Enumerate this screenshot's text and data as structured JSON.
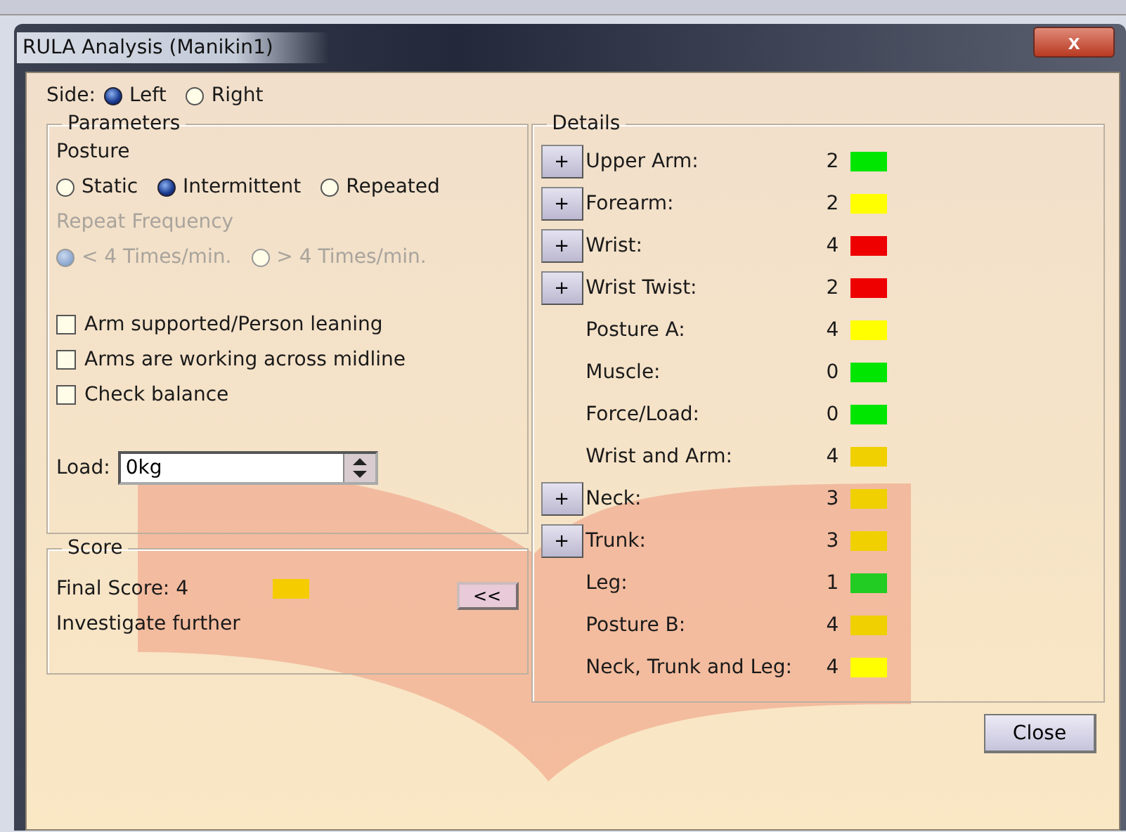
{
  "window": {
    "title": "RULA Analysis (Manikin1)",
    "close_glyph": "x"
  },
  "side": {
    "label": "Side:",
    "options": [
      {
        "label": "Left",
        "selected": true
      },
      {
        "label": "Right",
        "selected": false
      }
    ]
  },
  "parameters": {
    "title": "Parameters",
    "posture_label": "Posture",
    "posture_options": [
      {
        "label": "Static",
        "selected": false
      },
      {
        "label": "Intermittent",
        "selected": true
      },
      {
        "label": "Repeated",
        "selected": false
      }
    ],
    "frequency_label": "Repeat Frequency",
    "frequency_disabled": true,
    "frequency_options": [
      {
        "label": "< 4 Times/min.",
        "selected": true
      },
      {
        "label": "> 4 Times/min.",
        "selected": false
      }
    ],
    "checks": [
      {
        "label": "Arm supported/Person leaning",
        "checked": false
      },
      {
        "label": "Arms are working across midline",
        "checked": false
      },
      {
        "label": "Check balance",
        "checked": false
      }
    ],
    "load_label": "Load:",
    "load_value": "0kg"
  },
  "score": {
    "title": "Score",
    "final_label": "Final Score: 4",
    "color": "#f5cc00",
    "verdict": "Investigate further",
    "collapse_button": "<<"
  },
  "details": {
    "title": "Details",
    "rows": [
      {
        "kind": "expandable",
        "button": "+",
        "label": "Upper Arm:",
        "value": "2",
        "color": "#00e600"
      },
      {
        "kind": "expandable",
        "button": "+",
        "label": "Forearm:",
        "value": "2",
        "color": "#ffff00"
      },
      {
        "kind": "expandable",
        "button": "+",
        "label": "Wrist:",
        "value": "4",
        "color": "#ee0000"
      },
      {
        "kind": "expandable",
        "button": "+",
        "label": "Wrist Twist:",
        "value": "2",
        "color": "#ee0000"
      },
      {
        "kind": "plain",
        "label": "Posture A:",
        "value": "4",
        "color": "#ffff00"
      },
      {
        "kind": "plain",
        "label": "Muscle:",
        "value": "0",
        "color": "#00e600"
      },
      {
        "kind": "plain",
        "label": "Force/Load:",
        "value": "0",
        "color": "#00e600"
      },
      {
        "kind": "plain",
        "label": "Wrist and Arm:",
        "value": "4",
        "color": "#f0d000"
      },
      {
        "kind": "expandable",
        "button": "+",
        "label": "Neck:",
        "value": "3",
        "color": "#f0d000"
      },
      {
        "kind": "expandable",
        "button": "+",
        "label": "Trunk:",
        "value": "3",
        "color": "#f0d000"
      },
      {
        "kind": "plain",
        "label": "Leg:",
        "value": "1",
        "color": "#22cc22"
      },
      {
        "kind": "plain",
        "label": "Posture B:",
        "value": "4",
        "color": "#f0d000"
      },
      {
        "kind": "plain",
        "label": "Neck, Trunk and Leg:",
        "value": "4",
        "color": "#ffff00"
      }
    ]
  },
  "buttons": [
    {
      "label": "Close"
    }
  ]
}
